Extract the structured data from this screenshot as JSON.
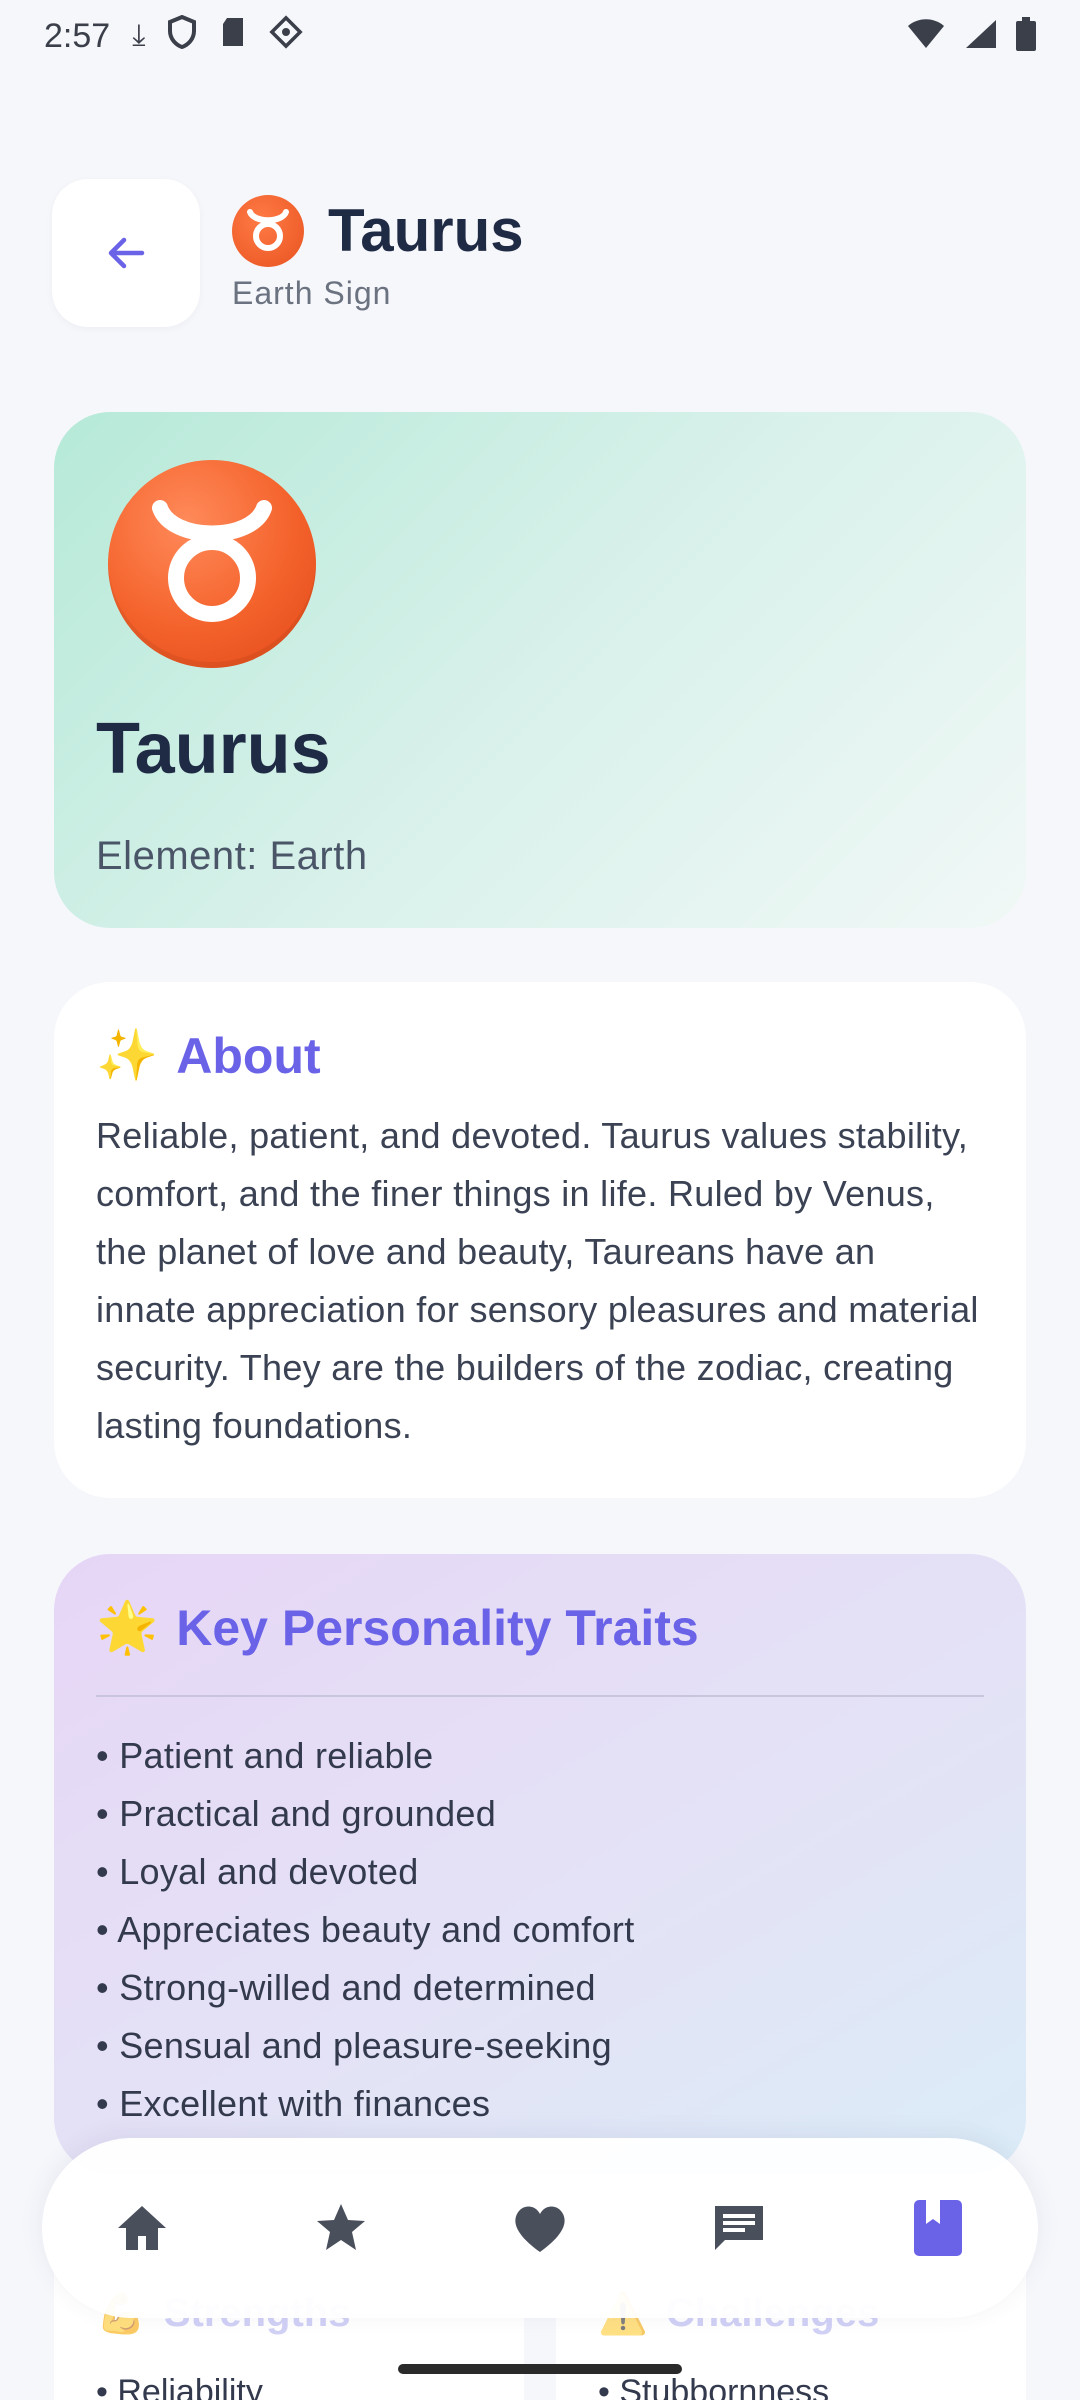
{
  "status_bar": {
    "time": "2:57"
  },
  "header": {
    "title": "Taurus",
    "subtitle": "Earth Sign"
  },
  "hero": {
    "title": "Taurus",
    "element_text": "Element: Earth"
  },
  "about": {
    "emoji": "✨",
    "title": "About",
    "body": "Reliable, patient, and devoted. Taurus values stability, comfort, and the finer things in life. Ruled by Venus, the planet of love and beauty, Taureans have an innate appreciation for sensory pleasures and material security. They are the builders of the zodiac, creating lasting foundations."
  },
  "traits": {
    "emoji": "🌟",
    "title": "Key Personality Traits",
    "items": [
      "• Patient and reliable",
      "• Practical and grounded",
      "• Loyal and devoted",
      "• Appreciates beauty and comfort",
      "• Strong-willed and determined",
      "• Sensual and pleasure-seeking",
      "• Excellent with finances"
    ]
  },
  "strengths": {
    "emoji": "💪",
    "title": "Strengths",
    "first_item": "• Reliability"
  },
  "challenges": {
    "emoji": "⚠️",
    "title": "Challenges",
    "first_item": "• Stubbornness"
  },
  "nav": {
    "items": [
      "home-icon",
      "star-icon",
      "heart-icon",
      "chat-icon",
      "book-icon"
    ],
    "active": "book-icon"
  },
  "colors": {
    "accent": "#6a63e8",
    "nav_inactive": "#4a4f5c",
    "taurus_orange": "#f4622b"
  }
}
